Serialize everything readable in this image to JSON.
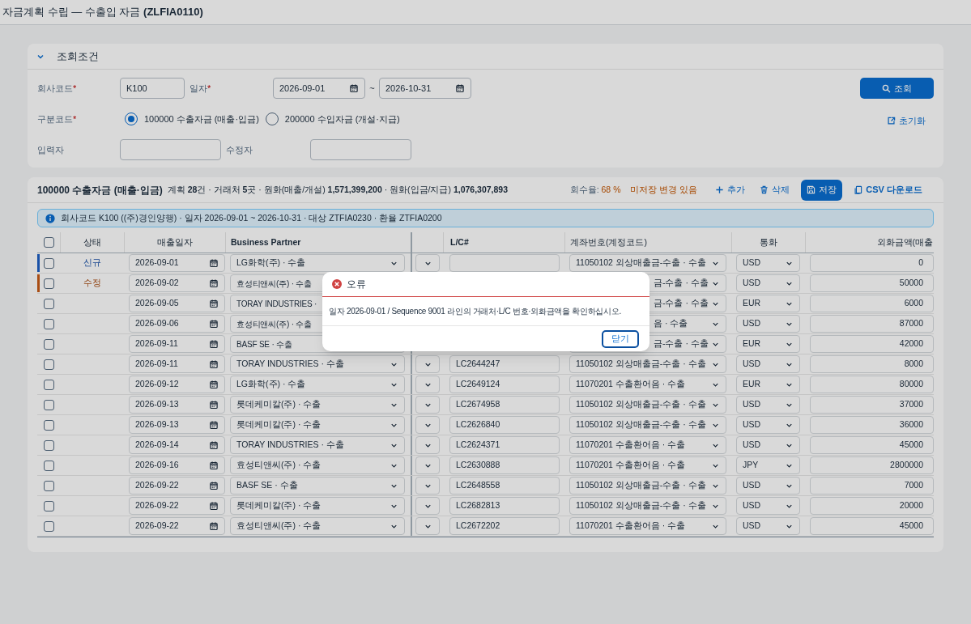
{
  "window": {
    "title": "자금계획 수립 — 수출입 자금 **(ZLFIA0110)**"
  },
  "search_panel": {
    "title": "조회조건",
    "expanded": true,
    "required_mark": "*",
    "company": {
      "label": "회사코드",
      "required": true,
      "value": "K100"
    },
    "date": {
      "label": "일자",
      "required": true,
      "from": "2026-09-01",
      "separator": "~",
      "to": "2026-10-31"
    },
    "type": {
      "label": "구분코드",
      "required": true,
      "options": [
        {
          "label": "100000 수출자금 (매출·입금)",
          "selected": true
        },
        {
          "label": "200000 수입자금 (개설·지급)",
          "selected": false
        }
      ]
    },
    "entered_by": {
      "label": "입력자"
    },
    "modified_by": {
      "label": "수정자"
    },
    "search_button": "조회",
    "reset_button": "초기화"
  },
  "results": {
    "title": "100000 수출자금 (매출·입금)",
    "summary": "계획 **28**건 · 거래처 **5**곳 · 원화(매출/개설) **1,571,399,200** · 원화(입금/지급) **1,076,307,893**",
    "recovery_label": "회수율:",
    "recovery_value": "68 %",
    "unsaved": "미저장 변경 있음",
    "actions": [
      {
        "kind": "add",
        "label": "추가"
      },
      {
        "kind": "delete",
        "label": "삭제"
      },
      {
        "kind": "save",
        "label": "저장"
      },
      {
        "kind": "csv",
        "label": "CSV 다운로드"
      }
    ],
    "info": "회사코드 K100 ((주)경인양행) · 일자 2026-09-01 ~ 2026-10-31 · 대상 ZTFIA0230 · 환율 ZTFIA0200",
    "select_all_checked": false,
    "columns": [
      "상태",
      "매출일자",
      "Business Partner",
      "L/C#",
      "계좌번호(계정코드)",
      "통화",
      "외화금액(매출"
    ],
    "rows": [
      {
        "kind": "full",
        "status": "신규",
        "color": "#1951a7",
        "checked": false,
        "date": "2026-09-01",
        "partner": "LG화학(주) · 수출",
        "account": "11050102 외상매출금-수출 · 수출",
        "currency": "USD",
        "amount": "0"
      },
      {
        "kind": "covered",
        "status": "수정",
        "color": "#a94d13",
        "checked": false,
        "date": "2026-09-02",
        "partner": "효성티앤씨(주) · 수출",
        "account": "금-수출 · 수출",
        "currency": "USD",
        "amount": "50000"
      },
      {
        "kind": "covered",
        "checked": false,
        "date": "2026-09-05",
        "partner": "TORAY INDUSTRIES ·",
        "account": "금-수출 · 수출",
        "currency": "EUR",
        "amount": "6000"
      },
      {
        "kind": "covered",
        "checked": false,
        "date": "2026-09-06",
        "partner": "효성티앤씨(주) · 수출",
        "account": "음 · 수출",
        "currency": "USD",
        "amount": "87000"
      },
      {
        "kind": "covered",
        "checked": false,
        "date": "2026-09-11",
        "partner": "BASF SE · 수출",
        "account": "금-수출 · 수출",
        "currency": "EUR",
        "amount": "42000"
      },
      {
        "kind": "full",
        "checked": false,
        "date": "2026-09-11",
        "partner": "TORAY INDUSTRIES · 수출",
        "lc": "LC2644247",
        "account": "11050102 외상매출금-수출 · 수출",
        "currency": "USD",
        "amount": "8000"
      },
      {
        "kind": "full",
        "checked": false,
        "date": "2026-09-12",
        "partner": "LG화학(주) · 수출",
        "lc": "LC2649124",
        "account": "11070201 수출환어음 · 수출",
        "currency": "EUR",
        "amount": "80000"
      },
      {
        "kind": "full",
        "checked": false,
        "date": "2026-09-13",
        "partner": "롯데케미칼(주) · 수출",
        "lc": "LC2674958",
        "account": "11050102 외상매출금-수출 · 수출",
        "currency": "USD",
        "amount": "37000"
      },
      {
        "kind": "full",
        "checked": false,
        "date": "2026-09-13",
        "partner": "롯데케미칼(주) · 수출",
        "lc": "LC2626840",
        "account": "11050102 외상매출금-수출 · 수출",
        "currency": "USD",
        "amount": "36000"
      },
      {
        "kind": "full",
        "checked": false,
        "date": "2026-09-14",
        "partner": "TORAY INDUSTRIES · 수출",
        "lc": "LC2624371",
        "account": "11070201 수출환어음 · 수출",
        "currency": "USD",
        "amount": "45000"
      },
      {
        "kind": "full",
        "checked": false,
        "date": "2026-09-16",
        "partner": "효성티앤씨(주) · 수출",
        "lc": "LC2630888",
        "account": "11070201 수출환어음 · 수출",
        "currency": "JPY",
        "amount": "2800000"
      },
      {
        "kind": "full",
        "checked": false,
        "date": "2026-09-22",
        "partner": "BASF SE · 수출",
        "lc": "LC2648558",
        "account": "11050102 외상매출금-수출 · 수출",
        "currency": "USD",
        "amount": "7000"
      },
      {
        "kind": "full",
        "checked": false,
        "date": "2026-09-22",
        "partner": "롯데케미칼(주) · 수출",
        "lc": "LC2682813",
        "account": "11050102 외상매출금-수출 · 수출",
        "currency": "USD",
        "amount": "20000"
      },
      {
        "kind": "full",
        "checked": false,
        "date": "2026-09-22",
        "partner": "효성티앤씨(주) · 수출",
        "lc": "LC2672202",
        "account": "11070201 수출환어음 · 수출",
        "currency": "USD",
        "amount": "45000"
      }
    ]
  },
  "dialog": {
    "title": "오류",
    "message": "일자 2026-09-01 / Sequence 9001 라인의 거래처·L/C 번호·외화금액을 확인하십시오.",
    "close_button": "닫기"
  }
}
